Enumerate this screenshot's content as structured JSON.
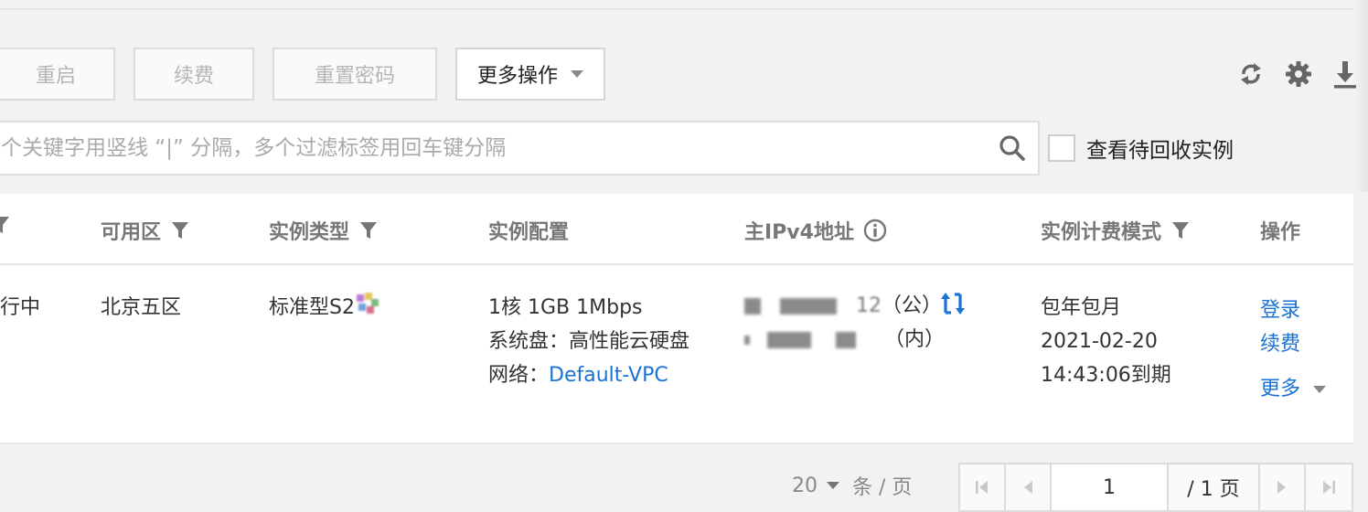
{
  "toolbar": {
    "restart_label": "重启",
    "renew_label": "续费",
    "reset_password_label": "重置密码",
    "more_actions_label": "更多操作"
  },
  "search": {
    "placeholder": "多个关键字用竖线 “|” 分隔，多个过滤标签用回车键分隔",
    "show_recycle_label": "查看待回收实例"
  },
  "table": {
    "headers": {
      "zone": "可用区",
      "instance_type": "实例类型",
      "instance_config": "实例配置",
      "ipv4": "主IPv4地址",
      "billing": "实例计费模式",
      "actions": "操作"
    },
    "row": {
      "status": "运行中",
      "zone": "北京五区",
      "instance_type": "标准型S2",
      "config_line1": "1核 1GB 1Mbps",
      "config_line2": "系统盘：高性能云硬盘",
      "network_label": "网络：",
      "network_value": "Default-VPC",
      "public_ip_suffix": "12",
      "public_tag": "（公）",
      "private_tag": "（内）",
      "billing_mode": "包年包月",
      "expiry_date": "2021-02-20",
      "expiry_time": "14:43:06到期",
      "action_login": "登录",
      "action_renew": "续费",
      "action_more": "更多"
    }
  },
  "pagination": {
    "page_size": "20",
    "page_size_unit": "条 / 页",
    "current_page": "1",
    "total_pages": "/ 1 页"
  },
  "colors": {
    "link": "#1a72d4",
    "background": "#f2f2f2",
    "border": "#dcdcdc"
  }
}
